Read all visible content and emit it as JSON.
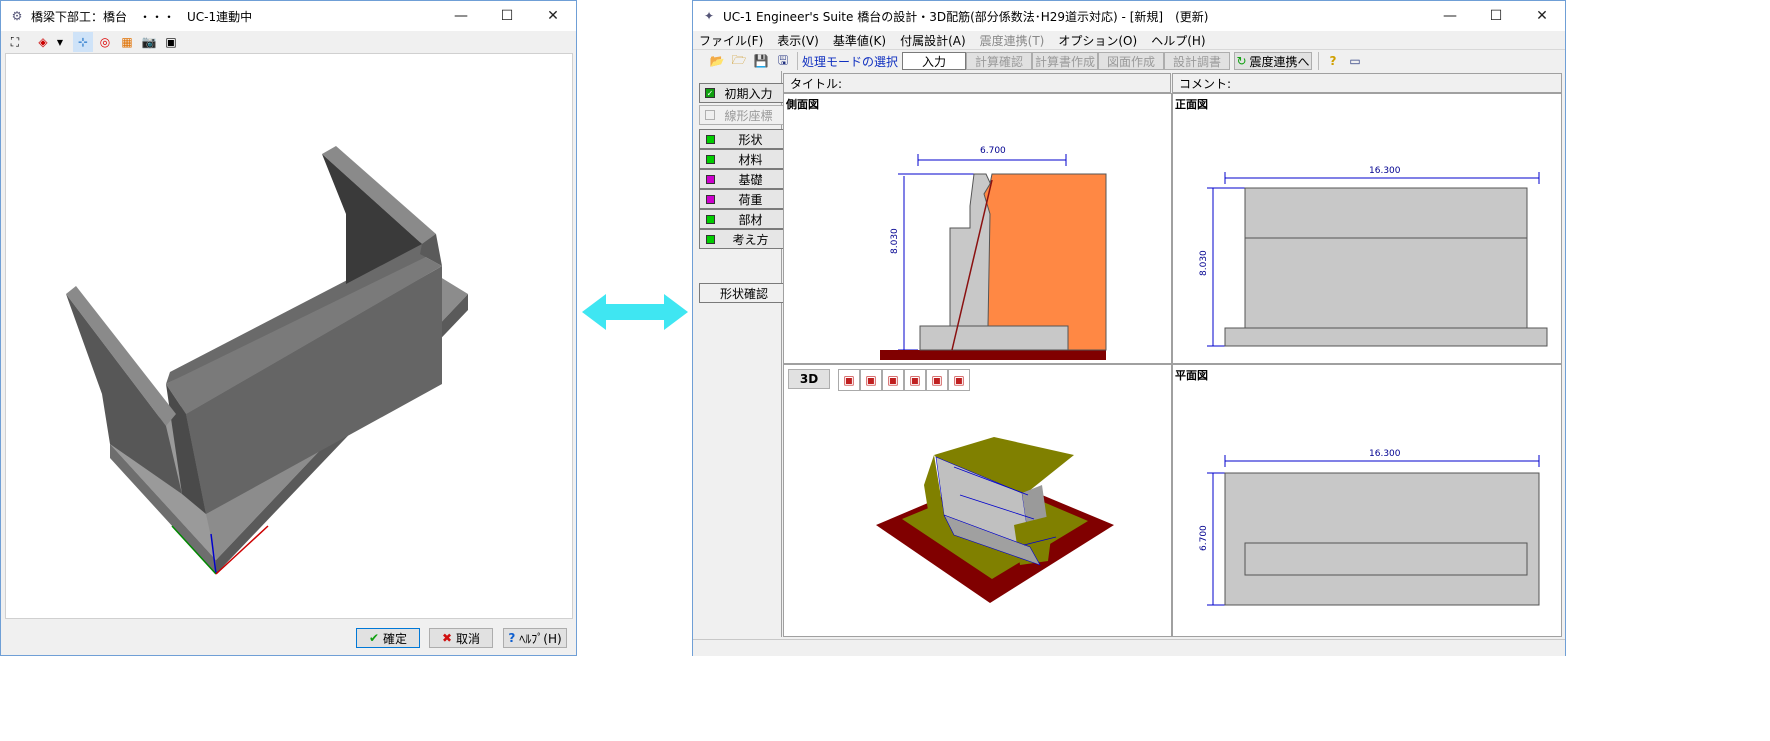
{
  "left_window": {
    "title": "橋梁下部工：橋台　・・・　UC-1連動中",
    "toolbar_icons": [
      "fit-view-icon",
      "view-mode-icon",
      "dropdown-arrow-icon",
      "axis-icon",
      "target-icon",
      "color-grid-icon",
      "camera-icon",
      "film-icon"
    ],
    "buttons": {
      "ok": "確定",
      "cancel": "取消",
      "help": "ﾍﾙﾌﾟ(H)"
    }
  },
  "right_window": {
    "title": "UC-1 Engineer's Suite 橋台の設計・3D配筋(部分係数法･H29道示対応) - [新規]　(更新)",
    "menu": [
      "ファイル(F)",
      "表示(V)",
      "基準値(K)",
      "付属設計(A)",
      "震度連携(T)",
      "オプション(O)",
      "ヘルプ(H)"
    ],
    "toolbar": {
      "mode_label": "処理モードの選択",
      "buttons": [
        "入力",
        "計算確認",
        "計算書作成",
        "図面作成",
        "設計調書"
      ],
      "seismic_button": "震度連携へ"
    },
    "header": {
      "title_label": "タイトル:",
      "comment_label": "コメント:"
    },
    "sidebar": {
      "top": {
        "label": "初期入力",
        "checked": true
      },
      "disabled": {
        "label": "線形座標"
      },
      "items": [
        {
          "label": "形状",
          "color": "#00cc00"
        },
        {
          "label": "材料",
          "color": "#00cc00"
        },
        {
          "label": "基礎",
          "color": "#cc00cc"
        },
        {
          "label": "荷重",
          "color": "#cc00cc"
        },
        {
          "label": "部材",
          "color": "#00cc00"
        },
        {
          "label": "考え方",
          "color": "#00cc00"
        }
      ],
      "confirm": "形状確認"
    },
    "panes": {
      "side": {
        "label": "側面図",
        "width_dim": "6.700",
        "height_dim": "8.030"
      },
      "front": {
        "label": "正面図",
        "width_dim": "16.300",
        "height_dim": "8.030"
      },
      "view3d": {
        "button": "3D"
      },
      "plan": {
        "label": "平面図",
        "width_dim": "16.300",
        "height_dim": "6.700"
      }
    }
  },
  "colors": {
    "arrow": "#3fe6f2",
    "fill_orange": "#ff8844",
    "ground_dark": "#800000",
    "dim_blue": "#0000cc",
    "concrete": "#c8c8c8"
  }
}
